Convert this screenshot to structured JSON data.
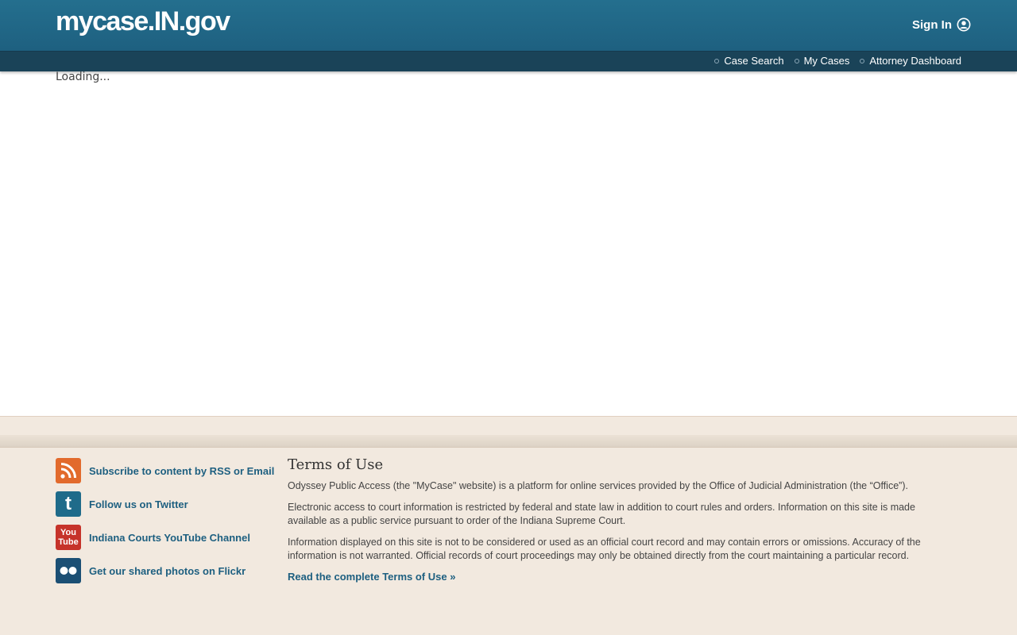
{
  "header": {
    "logo": "mycase.IN.gov",
    "signin_label": "Sign In"
  },
  "nav": {
    "items": [
      {
        "label": "Case Search"
      },
      {
        "label": "My Cases"
      },
      {
        "label": "Attorney Dashboard"
      }
    ]
  },
  "main": {
    "status_text": "Loading..."
  },
  "footer": {
    "social": [
      {
        "label": "Subscribe to content by RSS or Email",
        "icon": "rss-icon",
        "color": "#e26a2c"
      },
      {
        "label": "Follow us on Twitter",
        "icon": "twitter-icon",
        "color": "#1f6b8a"
      },
      {
        "label": "Indiana Courts YouTube Channel",
        "icon": "youtube-icon",
        "color": "#c6332a"
      },
      {
        "label": "Get our shared photos on Flickr",
        "icon": "flickr-icon",
        "color": "#1b4f74"
      }
    ],
    "youtube_icon_text": [
      "You",
      "Tube"
    ],
    "twitter_icon_text": "t",
    "terms": {
      "title": "Terms of Use",
      "paragraphs": [
        "Odyssey Public Access (the \"MyCase\" website) is a platform for online services provided by the Office of Judicial Administration (the “Office”).",
        "Electronic access to court information is restricted by federal and state law in addition to court rules and orders. Information on this site is made available as a public service pursuant to order of the Indiana Supreme Court.",
        "Information displayed on this site is not to be considered or used as an official court record and may contain errors or omissions. Accuracy of the information is not warranted. Official records of court proceedings may only be obtained directly from the court maintaining a particular record."
      ],
      "link_label": "Read the complete Terms of Use »"
    }
  },
  "colors": {
    "header_bg": "#246f8e",
    "nav_bg": "#1a4358",
    "footer_bg": "#f2e9df",
    "link": "#1d5f80"
  }
}
